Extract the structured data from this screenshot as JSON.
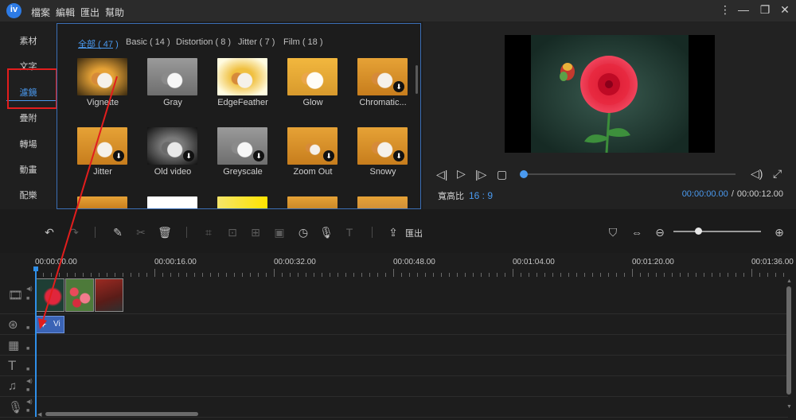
{
  "menu": {
    "items": [
      "檔案",
      "編輯",
      "匯出",
      "幫助"
    ]
  },
  "sidebar": {
    "items": [
      {
        "label": "素材",
        "active": false
      },
      {
        "label": "文字",
        "active": false
      },
      {
        "label": "濾鏡",
        "active": true
      },
      {
        "label": "疊附",
        "active": false
      },
      {
        "label": "轉場",
        "active": false
      },
      {
        "label": "動畫",
        "active": false
      },
      {
        "label": "配樂",
        "active": false
      }
    ]
  },
  "effects": {
    "tabs": [
      {
        "label": "全部 ( 47 )",
        "active": true
      },
      {
        "label": "Basic ( 14 )",
        "active": false
      },
      {
        "label": "Distortion ( 8 )",
        "active": false
      },
      {
        "label": "Jitter ( 7 )",
        "active": false
      },
      {
        "label": "Film ( 18 )",
        "active": false
      }
    ],
    "items": [
      {
        "name": "Vignette",
        "download": false,
        "style": "vignette"
      },
      {
        "name": "Gray",
        "download": false,
        "style": "gray"
      },
      {
        "name": "EdgeFeather",
        "download": false,
        "style": "feather"
      },
      {
        "name": "Glow",
        "download": false,
        "style": "glow"
      },
      {
        "name": "Chromatic...",
        "download": true,
        "style": "normal"
      },
      {
        "name": "Jitter",
        "download": true,
        "style": "normal"
      },
      {
        "name": "Old video",
        "download": true,
        "style": "old"
      },
      {
        "name": "Greyscale",
        "download": true,
        "style": "gray"
      },
      {
        "name": "Zoom Out",
        "download": true,
        "style": "zoomout"
      },
      {
        "name": "Snowy",
        "download": true,
        "style": "normal"
      }
    ]
  },
  "preview": {
    "aspect_label": "寬高比",
    "aspect_value": "16 : 9",
    "current_time": "00:00:00.00",
    "separator": "/",
    "total_time": "00:00:12.00",
    "progress": 0
  },
  "toolbar": {
    "export_label": "匯出",
    "zoom_level": 0.28
  },
  "timeline": {
    "ruler": [
      "00:00:00.00",
      "00:00:16.00",
      "00:00:32.00",
      "00:00:48.00",
      "00:01:04.00",
      "00:01:20.00",
      "00:01:36.00"
    ],
    "effect_clip_label": "Vi"
  },
  "colors": {
    "accent": "#4a9af0",
    "highlight": "#e21d1d",
    "effect_clip": "#3a63b5"
  }
}
